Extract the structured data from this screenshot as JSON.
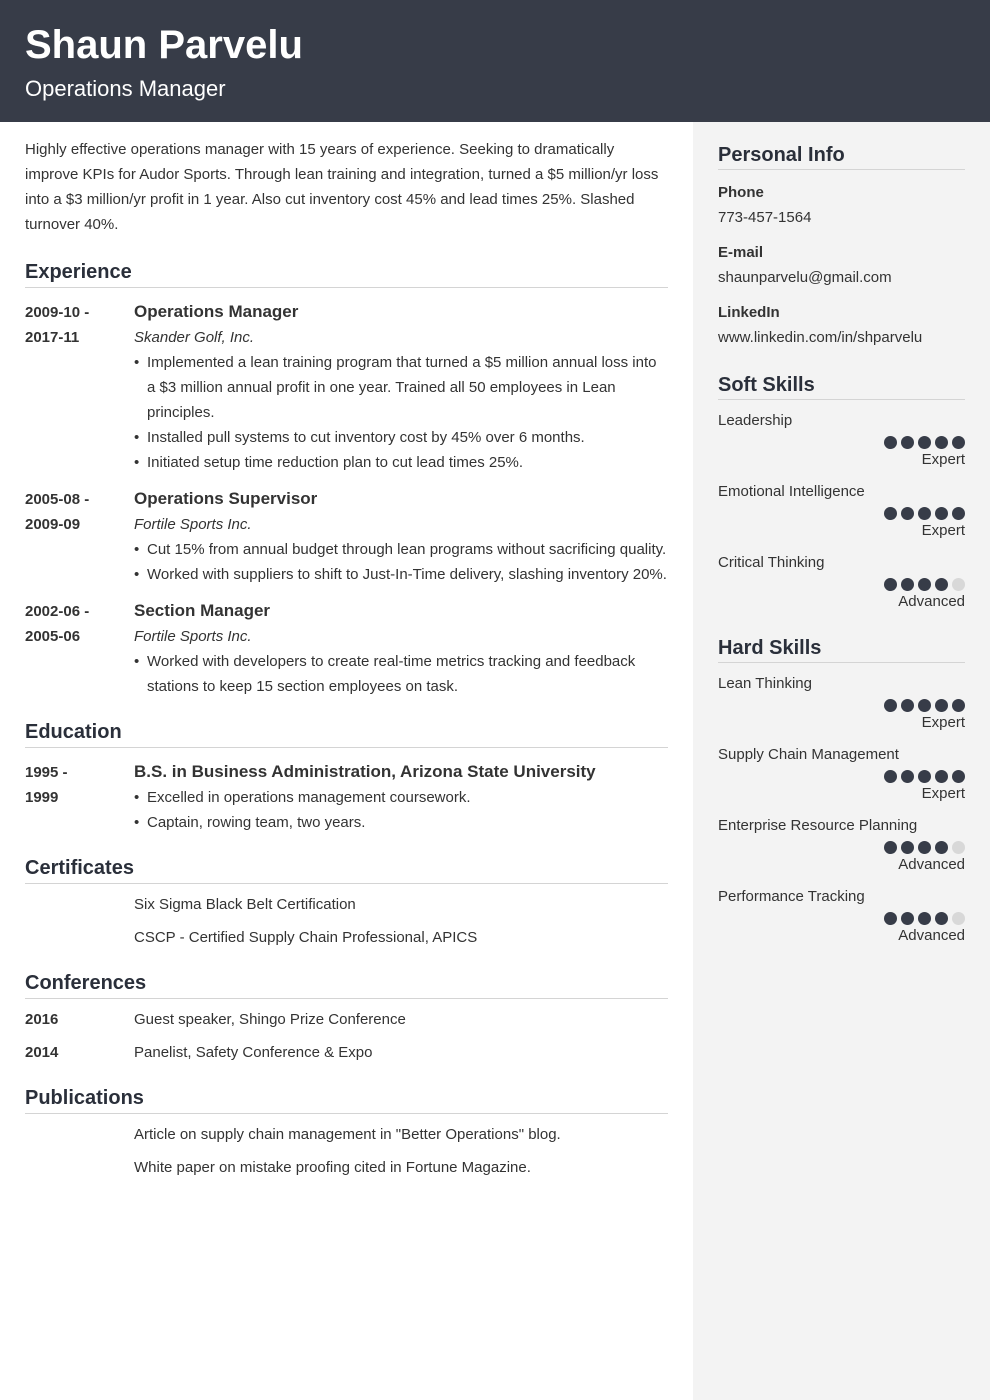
{
  "header": {
    "name": "Shaun Parvelu",
    "title": "Operations Manager"
  },
  "colors": {
    "header_bg": "#373c48",
    "sidebar_bg": "#f3f3f3",
    "dot_filled": "#373c48",
    "dot_empty": "#d8d8d8"
  },
  "summary": "Highly effective operations manager with 15 years of experience. Seeking to dramatically improve KPIs for Audor Sports. Through lean training and integration, turned a $5 million/yr loss into a $3 million/yr profit in 1 year. Also cut inventory cost 45% and lead times 25%. Slashed turnover 40%.",
  "experience": {
    "title": "Experience",
    "items": [
      {
        "date_start": "2009-10 -",
        "date_end": "2017-11",
        "role": "Operations Manager",
        "company": "Skander Golf, Inc.",
        "bullets": [
          "Implemented a lean training program that turned a $5 million annual loss into a $3 million annual profit in one year. Trained all 50 employees in Lean principles.",
          "Installed pull systems to cut inventory cost by 45% over 6 months.",
          "Initiated setup time reduction plan to cut lead times 25%."
        ]
      },
      {
        "date_start": "2005-08 -",
        "date_end": "2009-09",
        "role": "Operations Supervisor",
        "company": "Fortile Sports Inc.",
        "bullets": [
          "Cut 15% from annual budget through lean programs without sacrificing quality.",
          "Worked with suppliers to shift to Just-In-Time delivery, slashing inventory 20%."
        ]
      },
      {
        "date_start": "2002-06 -",
        "date_end": "2005-06",
        "role": "Section Manager",
        "company": "Fortile Sports Inc.",
        "bullets": [
          "Worked with developers to create real-time metrics tracking and feedback stations to keep 15 section employees on task."
        ]
      }
    ]
  },
  "education": {
    "title": "Education",
    "items": [
      {
        "date_start": "1995 -",
        "date_end": "1999",
        "degree": "B.S. in Business Administration, Arizona State University",
        "bullets": [
          "Excelled in operations management coursework.",
          "Captain, rowing team, two years."
        ]
      }
    ]
  },
  "certificates": {
    "title": "Certificates",
    "items": [
      "Six Sigma Black Belt Certification",
      "CSCP - Certified Supply Chain Professional, APICS"
    ]
  },
  "conferences": {
    "title": "Conferences",
    "items": [
      {
        "year": "2016",
        "text": "Guest speaker, Shingo Prize Conference"
      },
      {
        "year": "2014",
        "text": "Panelist, Safety Conference & Expo"
      }
    ]
  },
  "publications": {
    "title": "Publications",
    "items": [
      "Article on supply chain management in \"Better Operations\" blog.",
      "White paper on mistake proofing cited in Fortune Magazine."
    ]
  },
  "personal_info": {
    "title": "Personal Info",
    "fields": [
      {
        "label": "Phone",
        "value": "773-457-1564"
      },
      {
        "label": "E-mail",
        "value": "shaunparvelu@gmail.com"
      },
      {
        "label": "LinkedIn",
        "value": "www.linkedin.com/in/shparvelu"
      }
    ]
  },
  "soft_skills": {
    "title": "Soft Skills",
    "items": [
      {
        "name": "Leadership",
        "rating": 5,
        "max": 5,
        "level": "Expert"
      },
      {
        "name": "Emotional Intelligence",
        "rating": 5,
        "max": 5,
        "level": "Expert"
      },
      {
        "name": "Critical Thinking",
        "rating": 4,
        "max": 5,
        "level": "Advanced"
      }
    ]
  },
  "hard_skills": {
    "title": "Hard Skills",
    "items": [
      {
        "name": "Lean Thinking",
        "rating": 5,
        "max": 5,
        "level": "Expert"
      },
      {
        "name": "Supply Chain Management",
        "rating": 5,
        "max": 5,
        "level": "Expert"
      },
      {
        "name": "Enterprise Resource Planning",
        "rating": 4,
        "max": 5,
        "level": "Advanced"
      },
      {
        "name": "Performance Tracking",
        "rating": 4,
        "max": 5,
        "level": "Advanced"
      }
    ]
  }
}
